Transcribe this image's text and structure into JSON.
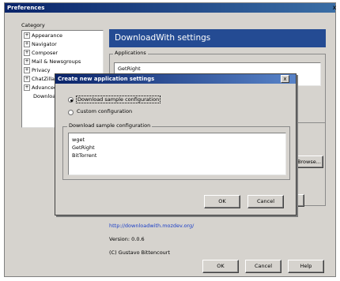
{
  "window": {
    "title": "Preferences",
    "close_glyph": "x"
  },
  "category": {
    "label": "Category",
    "items": [
      {
        "label": "Appearance",
        "expander": "⊞"
      },
      {
        "label": "Navigator",
        "expander": "⊞"
      },
      {
        "label": "Composer",
        "expander": "⊞"
      },
      {
        "label": "Mail & Newsgroups",
        "expander": "⊞"
      },
      {
        "label": "Privacy",
        "expander": "⊞"
      },
      {
        "label": "ChatZilla",
        "expander": "⊞"
      },
      {
        "label": "Advanced",
        "expander": "⊞"
      },
      {
        "label": "DownloadWith",
        "expander": ""
      }
    ]
  },
  "panel": {
    "title": "DownloadWith settings",
    "applications_label": "Applications",
    "applications": [
      "GetRight"
    ],
    "browse_button": "Browse...",
    "homepage_link": "http://downloadwith.mozdev.org/",
    "version": "Version: 0.0.6",
    "copyright": "(C) Gustavo Bittencourt"
  },
  "footer": {
    "ok": "OK",
    "cancel": "Cancel",
    "help": "Help"
  },
  "dialog": {
    "title": "Create new application settings",
    "close_glyph": "x",
    "option_sample": "Download sample configuration",
    "option_custom": "Custom configuration",
    "group_label": "Download sample configuration",
    "samples": [
      "wget",
      "GetRight",
      "BitTorrent"
    ],
    "ok": "OK",
    "cancel": "Cancel"
  },
  "colors": {
    "banner": "#244b93",
    "titlebar": "#0a246a",
    "face": "#d6d3ce",
    "link": "#1a3ec8"
  }
}
